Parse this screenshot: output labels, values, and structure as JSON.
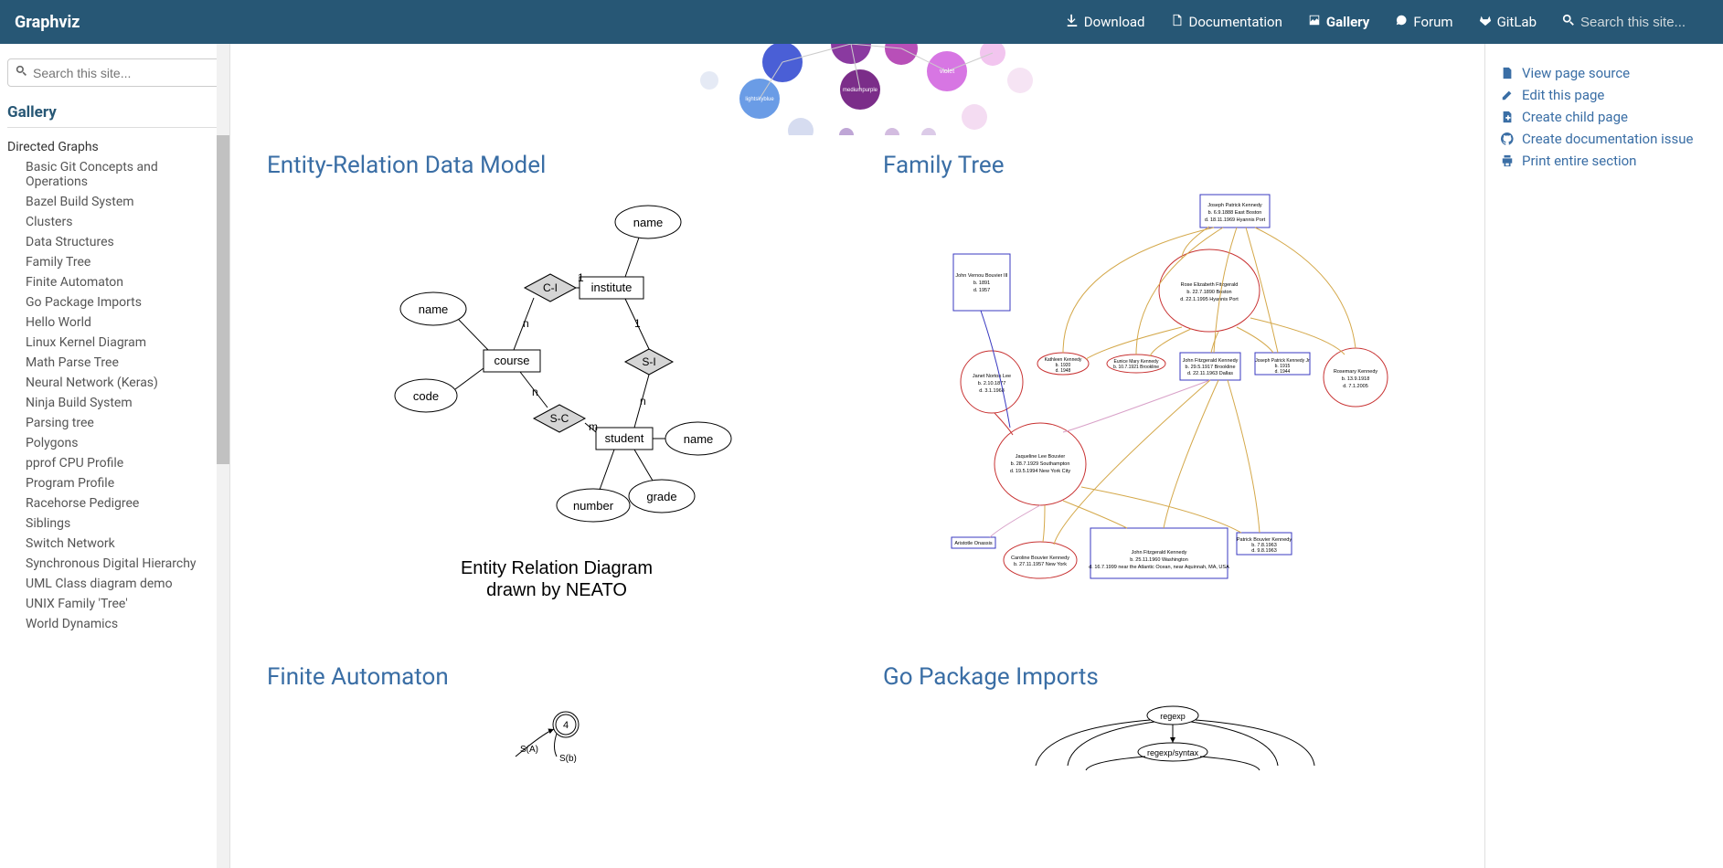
{
  "brand": "Graphviz",
  "topnav": {
    "download": "Download",
    "documentation": "Documentation",
    "gallery": "Gallery",
    "forum": "Forum",
    "gitlab": "GitLab"
  },
  "search_placeholder": "Search this site...",
  "sidebar": {
    "section_title": "Gallery",
    "category": "Directed Graphs",
    "items": [
      "Basic Git Concepts and Operations",
      "Bazel Build System",
      "Clusters",
      "Data Structures",
      "Family Tree",
      "Finite Automaton",
      "Go Package Imports",
      "Hello World",
      "Linux Kernel Diagram",
      "Math Parse Tree",
      "Neural Network (Keras)",
      "Ninja Build System",
      "Parsing tree",
      "Polygons",
      "pprof CPU Profile",
      "Program Profile",
      "Racehorse Pedigree",
      "Siblings",
      "Switch Network",
      "Synchronous Digital Hierarchy",
      "UML Class diagram demo",
      "UNIX Family 'Tree'",
      "World Dynamics"
    ]
  },
  "cards": {
    "er": "Entity-Relation Data Model",
    "family": "Family Tree",
    "finite": "Finite Automaton",
    "gopkg": "Go Package Imports"
  },
  "er_diagram": {
    "name_top": "name",
    "institute": "institute",
    "course": "course",
    "name_left": "name",
    "code": "code",
    "student": "student",
    "name_right": "name",
    "number": "number",
    "grade": "grade",
    "ci": "C-I",
    "si": "S-I",
    "sc": "S-C",
    "one": "1",
    "n1": "n",
    "n2": "n",
    "n3": "n",
    "one2": "1",
    "m": "m",
    "caption1": "Entity Relation Diagram",
    "caption2": "drawn by NEATO"
  },
  "family_nodes": {
    "jpk": "Joseph Patrick Kennedy\nb. 6.9.1888 East Boston\nd. 18.11.1969 Hyannis Port",
    "jvb": "John Vernou Bouvier III\nb. 1891\nd. 1957",
    "ref": "Rose Elizabeth Fitzgerald\nb. 22.7.1890 Boston\nd. 22.1.1995 Hyannis Port",
    "kk": "Kathleen Kennedy\nb. 1920\nd. 1948",
    "emk": "Eunice Mary Kennedy\nb. 10.7.1921 Brookline",
    "jnl": "Janet Norton Lee\nb. 2.10.1877\nd. 3.1.1968",
    "jfk": "John Fitzgerald Kennedy\nb. 29.5.1917 Brookline\nd. 22.11.1963 Dallas",
    "jpkj": "Joseph Patrick Kennedy Jr\nb. 1915\nd. 1944",
    "rk": "Rosemary Kennedy\nb. 13.9.1918\nd. 7.1.2005",
    "jlb": "Jaqueline Lee Bouvier\nb. 28.7.1929 Southampton\nd. 19.5.1994 New York City",
    "ao": "Aristotle Onassis",
    "cbk": "Caroline Bouvier Kennedy\nb. 27.11.1957 New York",
    "jfk2": "John Fitzgerald Kennedy\nb. 25.11.1960 Washington\nd. 16.7.1999 near the Atlantic Ocean, near Aquinnah, MA, USA",
    "pbk": "Patrick Bouvier Kennedy\nb. 7.8.1963\nd. 9.8.1963"
  },
  "automaton": {
    "four": "4",
    "sa": "S(A)",
    "sb": "S(b)"
  },
  "gopkg_nodes": {
    "regexp": "regexp",
    "syntax": "regexp/syntax"
  },
  "right": {
    "view_source": "View page source",
    "edit": "Edit this page",
    "create_child": "Create child page",
    "create_doc": "Create documentation issue",
    "print": "Print entire section"
  }
}
